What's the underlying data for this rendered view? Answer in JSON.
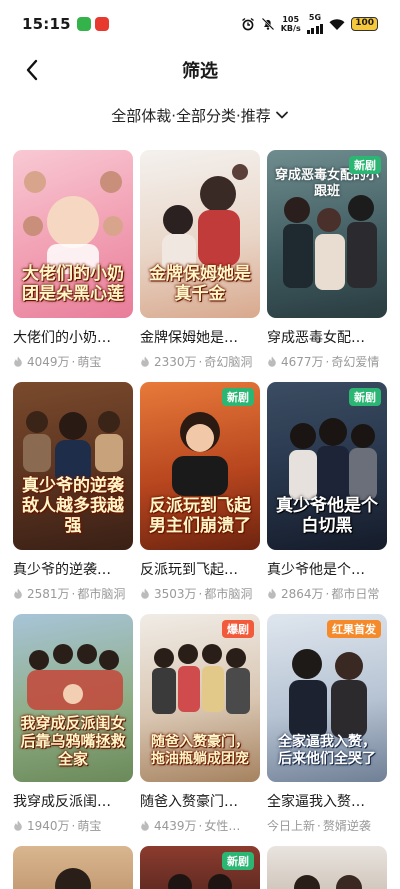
{
  "status_bar": {
    "time": "15:15",
    "net_speed_value": "105",
    "net_speed_unit": "KB/s",
    "network": "5G",
    "battery": "100",
    "icons": [
      "alarm-icon",
      "mute-icon",
      "signal-icon",
      "wifi-icon",
      "battery-icon"
    ]
  },
  "nav": {
    "title": "筛选",
    "back_icon": "chevron-left-icon"
  },
  "filter": {
    "label": "全部体裁·全部分类·推荐",
    "icon": "chevron-down-icon"
  },
  "colors": {
    "badge_new": "#2bb673",
    "badge_hot": "#f15a3b",
    "badge_premiere": "#f58a2a",
    "meta_text": "#999999"
  },
  "dramas": [
    {
      "title": "大佬们的小奶团是朵黑心莲",
      "display_title": "大佬们的小奶…",
      "poster_text": "大佬们的小奶团是朵黑心莲",
      "views": "4049万",
      "tag": "萌宝",
      "badge": "",
      "meta_icon": "flame-icon"
    },
    {
      "title": "金牌保姆她是真千金",
      "display_title": "金牌保姆她是…",
      "poster_text": "金牌保姆她是真千金",
      "views": "2330万",
      "tag": "奇幻脑洞",
      "badge": "",
      "meta_icon": "flame-icon"
    },
    {
      "title": "穿成恶毒女配的小跟班",
      "display_title": "穿成恶毒女配…",
      "poster_text": "穿成恶毒女配的小跟班",
      "views": "4677万",
      "tag": "奇幻爱情",
      "badge": "新剧",
      "meta_icon": "flame-icon"
    },
    {
      "title": "真少爷的逆袭",
      "display_title": "真少爷的逆袭…",
      "poster_text": "真少爷的逆袭敌人越多我越强",
      "views": "2581万",
      "tag": "都市脑洞",
      "badge": "",
      "meta_icon": "flame-icon"
    },
    {
      "title": "反派玩到飞起男主们崩溃了",
      "display_title": "反派玩到飞起…",
      "poster_text": "反派玩到飞起男主们崩溃了",
      "views": "3503万",
      "tag": "都市脑洞",
      "badge": "新剧",
      "meta_icon": "flame-icon"
    },
    {
      "title": "真少爷他是个白切黑",
      "display_title": "真少爷他是个…",
      "poster_text": "真少爷他是个白切黑",
      "views": "2864万",
      "tag": "都市日常",
      "badge": "新剧",
      "meta_icon": "flame-icon"
    },
    {
      "title": "我穿成反派闺女后靠乌鸦嘴拯救全家",
      "display_title": "我穿成反派闺…",
      "poster_text": "我穿成反派闺女后靠乌鸦嘴拯救全家",
      "views": "1940万",
      "tag": "萌宝",
      "badge": "",
      "meta_icon": "flame-icon"
    },
    {
      "title": "随爸入赘豪门，拖油瓶躺成团宠",
      "display_title": "随爸入赘豪门…",
      "poster_text": "随爸入赘豪门，拖油瓶躺成团宠",
      "views": "4439万",
      "tag": "女性…",
      "badge": "爆剧",
      "meta_icon": "flame-icon"
    },
    {
      "title": "全家逼我入赘，后来他们全哭了",
      "display_title": "全家逼我入赘…",
      "poster_text": "全家逼我入赘，后来他们全哭了",
      "views": "今日上新",
      "tag": "赘婿逆袭",
      "badge": "红果首发",
      "meta_icon": ""
    },
    {
      "title": "",
      "display_title": "",
      "poster_text": "",
      "views": "",
      "tag": "",
      "badge": "",
      "meta_icon": ""
    },
    {
      "title": "",
      "display_title": "",
      "poster_text": "",
      "views": "",
      "tag": "",
      "badge": "新剧",
      "meta_icon": ""
    },
    {
      "title": "",
      "display_title": "",
      "poster_text": "",
      "views": "",
      "tag": "",
      "badge": "",
      "meta_icon": ""
    }
  ]
}
